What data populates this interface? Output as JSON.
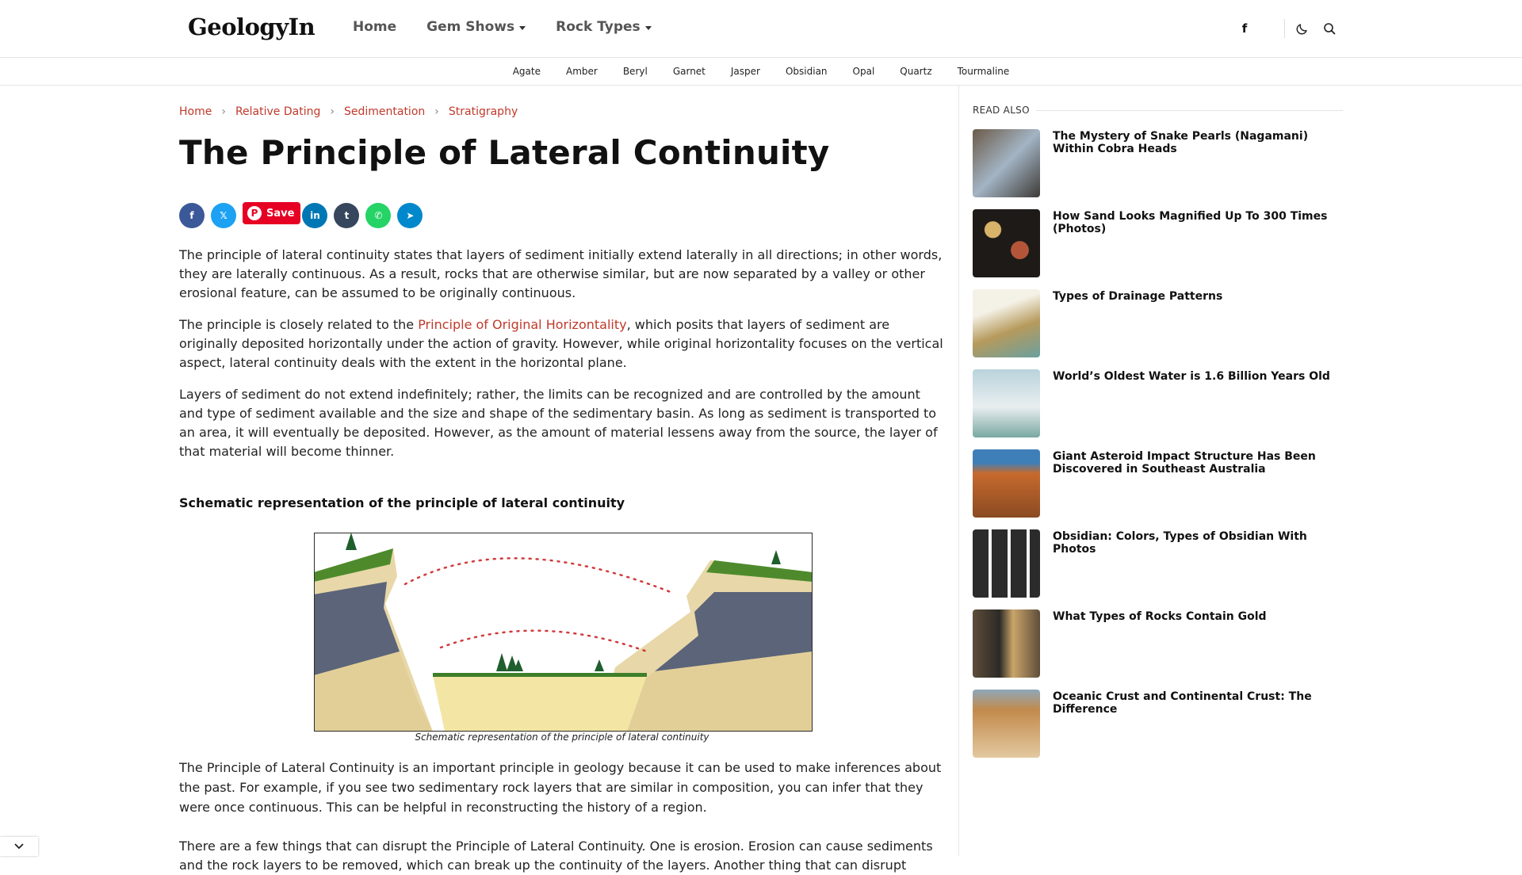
{
  "header": {
    "logo": "GeologyIn",
    "nav": [
      {
        "label": "Home",
        "dropdown": false
      },
      {
        "label": "Gem Shows",
        "dropdown": true
      },
      {
        "label": "Rock Types",
        "dropdown": true
      }
    ],
    "facebook_icon": "f",
    "icons": [
      "facebook-icon",
      "moon-icon",
      "search-icon"
    ]
  },
  "subnav": [
    "Agate",
    "Amber",
    "Beryl",
    "Garnet",
    "Jasper",
    "Obsidian",
    "Opal",
    "Quartz",
    "Tourmaline"
  ],
  "breadcrumb": [
    "Home",
    "Relative Dating",
    "Sedimentation",
    "Stratigraphy"
  ],
  "article": {
    "title": "The Principle of Lateral Continuity",
    "share": {
      "pinterest_label": "Save",
      "buttons": [
        {
          "name": "facebook",
          "glyph": "f",
          "color": "#3b5998"
        },
        {
          "name": "x",
          "glyph": "𝕏",
          "color": "#1da1f2"
        },
        {
          "name": "linkedin",
          "glyph": "in",
          "color": "#0077b5"
        },
        {
          "name": "tumblr",
          "glyph": "t",
          "color": "#36465d"
        },
        {
          "name": "whatsapp",
          "glyph": "✆",
          "color": "#25d366"
        },
        {
          "name": "telegram",
          "glyph": "➤",
          "color": "#0088cc"
        }
      ]
    },
    "p1": "The principle of lateral continuity states that layers of sediment initially extend laterally in all directions; in other words, they are laterally continuous. As a result, rocks that are otherwise similar, but are now separated by a valley or other erosional feature, can be assumed to be originally continuous.",
    "p2_before": "The principle is closely related to the ",
    "p2_link": "Principle of Original Horizontality",
    "p2_after": ", which posits that layers of sediment are originally deposited horizontally under the action of gravity. However, while original horizontality focuses on the vertical aspect, lateral continuity deals with the extent in the horizontal plane.",
    "p3": "Layers of sediment do not extend indefinitely; rather, the limits can be recognized and are controlled by the amount and type of sediment available and the size and shape of the sedimentary basin. As long as sediment is transported to an area, it will eventually be deposited. However, as the amount of material lessens away from the source, the layer of that material will become thinner.",
    "subheading": "Schematic representation of the principle of lateral continuity",
    "caption": "Schematic representation of the principle of lateral continuity",
    "p4": "The Principle of Lateral Continuity is an important principle in geology because it can be used to make inferences about the past. For example, if you see two sedimentary rock layers that are similar in composition, you can infer that they were once continuous. This can be helpful in reconstructing the history of a region.",
    "p5": "There are a few things that can disrupt the Principle of Lateral Continuity. One is erosion. Erosion can cause sediments and the rock layers to be removed, which can break up the continuity of the layers. Another thing that can disrupt"
  },
  "sidebar": {
    "title": "READ ALSO",
    "posts": [
      {
        "title": "The Mystery of Snake Pearls (Nagamani) Within Cobra Heads",
        "colors": [
          "#6b5a48",
          "#a3b4c4",
          "#3d3a36"
        ]
      },
      {
        "title": "How Sand Looks Magnified Up To 300 Times (Photos)",
        "colors": [
          "#1e1a17",
          "#b4553a",
          "#d8b36a"
        ]
      },
      {
        "title": "Types of Drainage Patterns",
        "colors": [
          "#f4f1e6",
          "#b69a5c",
          "#6aa0a0"
        ]
      },
      {
        "title": "World’s Oldest Water is 1.6 Billion Years Old",
        "colors": [
          "#b9d3dc",
          "#e9eef0",
          "#79a8a2"
        ]
      },
      {
        "title": "Giant Asteroid Impact Structure Has Been Discovered in Southeast Australia",
        "colors": [
          "#3f7fb8",
          "#c76a2e",
          "#8a4a22"
        ]
      },
      {
        "title": "Obsidian: Colors, Types of Obsidian With Photos",
        "colors": [
          "#f2f2f2",
          "#2b2b2b",
          "#3b8f6a"
        ]
      },
      {
        "title": "What Types of Rocks Contain Gold",
        "colors": [
          "#5e4d3a",
          "#c9a56a",
          "#2c2a26"
        ]
      },
      {
        "title": "Oceanic Crust and Continental Crust: The Difference",
        "colors": [
          "#c28a4c",
          "#8fa7b8",
          "#e3c9a0"
        ]
      }
    ]
  },
  "colors": {
    "accent": "#c0392b"
  }
}
